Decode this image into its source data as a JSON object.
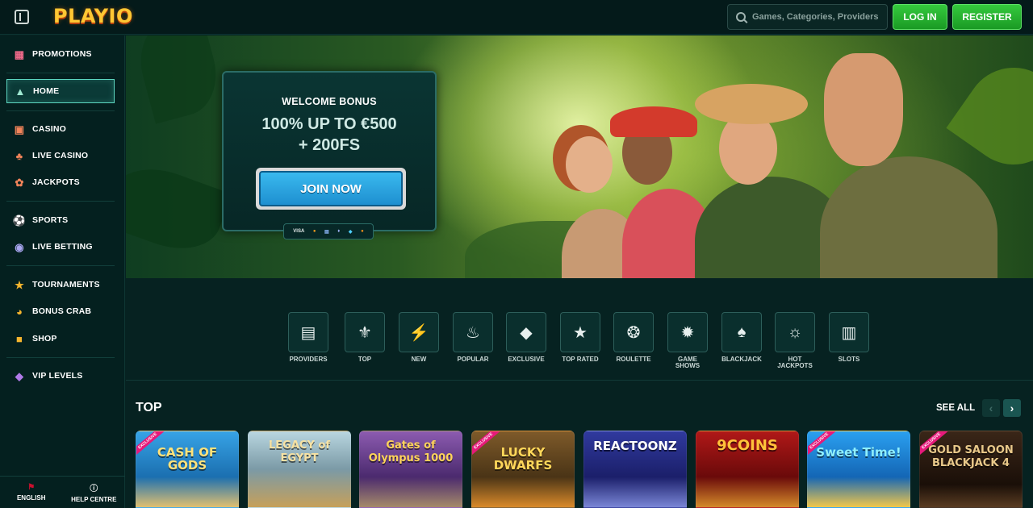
{
  "header": {
    "logo": "PLAYIO",
    "search_placeholder": "Games, Categories, Providers",
    "login_label": "LOG IN",
    "register_label": "REGISTER"
  },
  "sidebar": {
    "items": [
      {
        "label": "PROMOTIONS",
        "icon": "gift-icon"
      },
      {
        "label": "HOME",
        "icon": "home-icon"
      },
      {
        "label": "CASINO",
        "icon": "casino-icon"
      },
      {
        "label": "LIVE CASINO",
        "icon": "live-casino-icon"
      },
      {
        "label": "JACKPOTS",
        "icon": "jackpot-icon"
      },
      {
        "label": "SPORTS",
        "icon": "sports-icon"
      },
      {
        "label": "LIVE BETTING",
        "icon": "live-betting-icon"
      },
      {
        "label": "TOURNAMENTS",
        "icon": "trophy-icon"
      },
      {
        "label": "BONUS CRAB",
        "icon": "crab-icon"
      },
      {
        "label": "SHOP",
        "icon": "shop-icon"
      },
      {
        "label": "VIP LEVELS",
        "icon": "diamond-icon"
      }
    ],
    "footer": {
      "language": "ENGLISH",
      "help": "HELP CENTRE"
    }
  },
  "hero": {
    "bonus_title": "WELCOME BONUS",
    "bonus_line1": "100% UP TO €500",
    "bonus_line2": "+ 200FS",
    "cta": "JOIN NOW",
    "payment_label": "VISA"
  },
  "categories": [
    {
      "label": "PROVIDERS",
      "icon": "providers-icon"
    },
    {
      "label": "TOP",
      "icon": "fleur-icon"
    },
    {
      "label": "NEW",
      "icon": "lightning-icon"
    },
    {
      "label": "POPULAR",
      "icon": "flame-icon"
    },
    {
      "label": "EXCLUSIVE",
      "icon": "gem-icon"
    },
    {
      "label": "TOP RATED",
      "icon": "star-icon"
    },
    {
      "label": "ROULETTE",
      "icon": "roulette-icon"
    },
    {
      "label": "GAME SHOWS",
      "icon": "wheel-icon"
    },
    {
      "label": "BLACKJACK",
      "icon": "spade-icon"
    },
    {
      "label": "HOT JACKPOTS",
      "icon": "hot-jackpot-icon"
    },
    {
      "label": "SLOTS",
      "icon": "slots-icon"
    }
  ],
  "top_section": {
    "title": "TOP",
    "see_all": "SEE ALL",
    "games": [
      {
        "title": "CASH OF GODS",
        "badge": "EXCLUSIVE",
        "color": "#1b7fc4"
      },
      {
        "title": "LEGACY of EGYPT",
        "badge": "",
        "color": "#6a97a8"
      },
      {
        "title": "Gates of Olympus 1000",
        "badge": "",
        "color": "#6a3d8f"
      },
      {
        "title": "LUCKY DWARFS",
        "badge": "EXCLUSIVE",
        "color": "#6b4a1e"
      },
      {
        "title": "REACTOONZ",
        "badge": "",
        "color": "#2a2f8e"
      },
      {
        "title": "9COINS",
        "badge": "",
        "color": "#9c1212"
      },
      {
        "title": "Sweet Time!",
        "badge": "EXCLUSIVE",
        "color": "#1a86d6"
      },
      {
        "title": "GOLD SALOON BLACKJACK 4",
        "badge": "EXCLUSIVE",
        "color": "#2a1b12"
      }
    ]
  },
  "colors": {
    "accent_green": "#2fb83a",
    "active_border": "#5dd6c0",
    "join_blue": "#2aa6e2",
    "logo_gold": "#ffc733"
  }
}
